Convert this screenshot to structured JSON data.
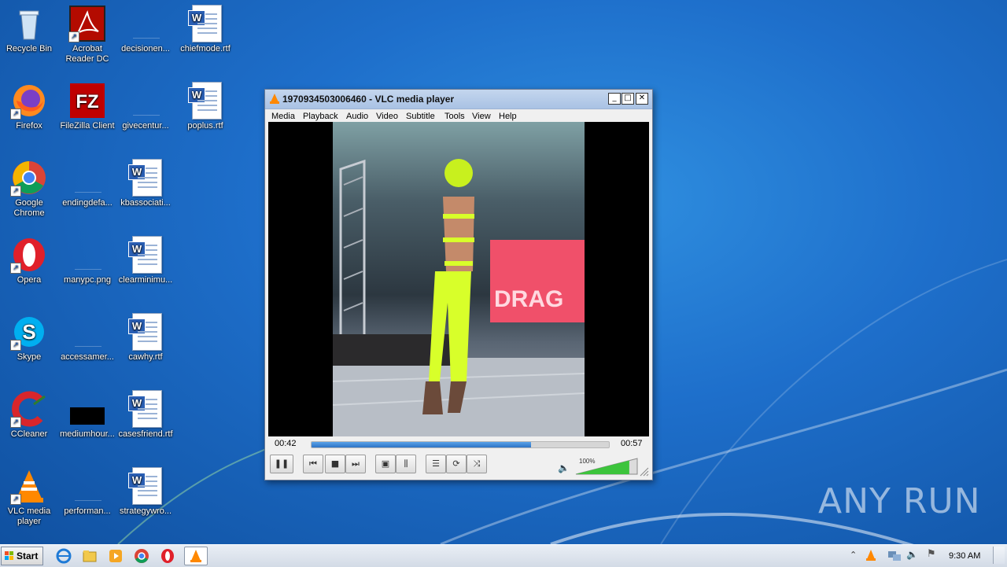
{
  "desktop": {
    "icons": [
      {
        "label": "Recycle Bin",
        "icon": "recycle-bin-icon"
      },
      {
        "label": "Acrobat Reader DC",
        "icon": "acrobat-icon"
      },
      {
        "label": "decisionen...",
        "icon": "file-icon"
      },
      {
        "label": "chiefmode.rtf",
        "icon": "word-doc-icon"
      },
      {
        "label": "Firefox",
        "icon": "firefox-icon"
      },
      {
        "label": "FileZilla Client",
        "icon": "filezilla-icon"
      },
      {
        "label": "givecentur...",
        "icon": "file-icon"
      },
      {
        "label": "poplus.rtf",
        "icon": "word-doc-icon"
      },
      {
        "label": "Google Chrome",
        "icon": "chrome-icon"
      },
      {
        "label": "endingdefa...",
        "icon": "file-icon"
      },
      {
        "label": "kbassociati...",
        "icon": "word-doc-icon"
      },
      {
        "label": "Opera",
        "icon": "opera-icon"
      },
      {
        "label": "manypc.png",
        "icon": "file-icon"
      },
      {
        "label": "clearminimu...",
        "icon": "word-doc-icon"
      },
      {
        "label": "Skype",
        "icon": "skype-icon"
      },
      {
        "label": "accessamer...",
        "icon": "file-icon"
      },
      {
        "label": "cawhy.rtf",
        "icon": "word-doc-icon"
      },
      {
        "label": "CCleaner",
        "icon": "ccleaner-icon"
      },
      {
        "label": "mediumhour...",
        "icon": "image-file-icon"
      },
      {
        "label": "casesfriend.rtf",
        "icon": "word-doc-icon"
      },
      {
        "label": "VLC media player",
        "icon": "vlc-icon"
      },
      {
        "label": "performan...",
        "icon": "file-icon"
      },
      {
        "label": "strategywro...",
        "icon": "word-doc-icon"
      }
    ]
  },
  "vlc": {
    "title": "1970934503006460 - VLC media player",
    "menu": [
      "Media",
      "Playback",
      "Audio",
      "Video",
      "Subtitle",
      "Tools",
      "View",
      "Help"
    ],
    "elapsed": "00:42",
    "total": "00:57",
    "progress_fraction": 0.737,
    "volume_label": "100%",
    "volume_fraction": 1.0,
    "video_sign_text": "DRAG"
  },
  "taskbar": {
    "start_label": "Start",
    "clock": "9:30 AM",
    "pinned": [
      "internet-explorer-icon",
      "file-explorer-icon",
      "media-player-icon",
      "chrome-icon",
      "opera-icon",
      "vlc-icon"
    ]
  },
  "watermark": "ANY RUN",
  "colors": {
    "accent": "#2f74c6",
    "volume": "#3cc43c",
    "desktop": "#1e6fcb"
  }
}
